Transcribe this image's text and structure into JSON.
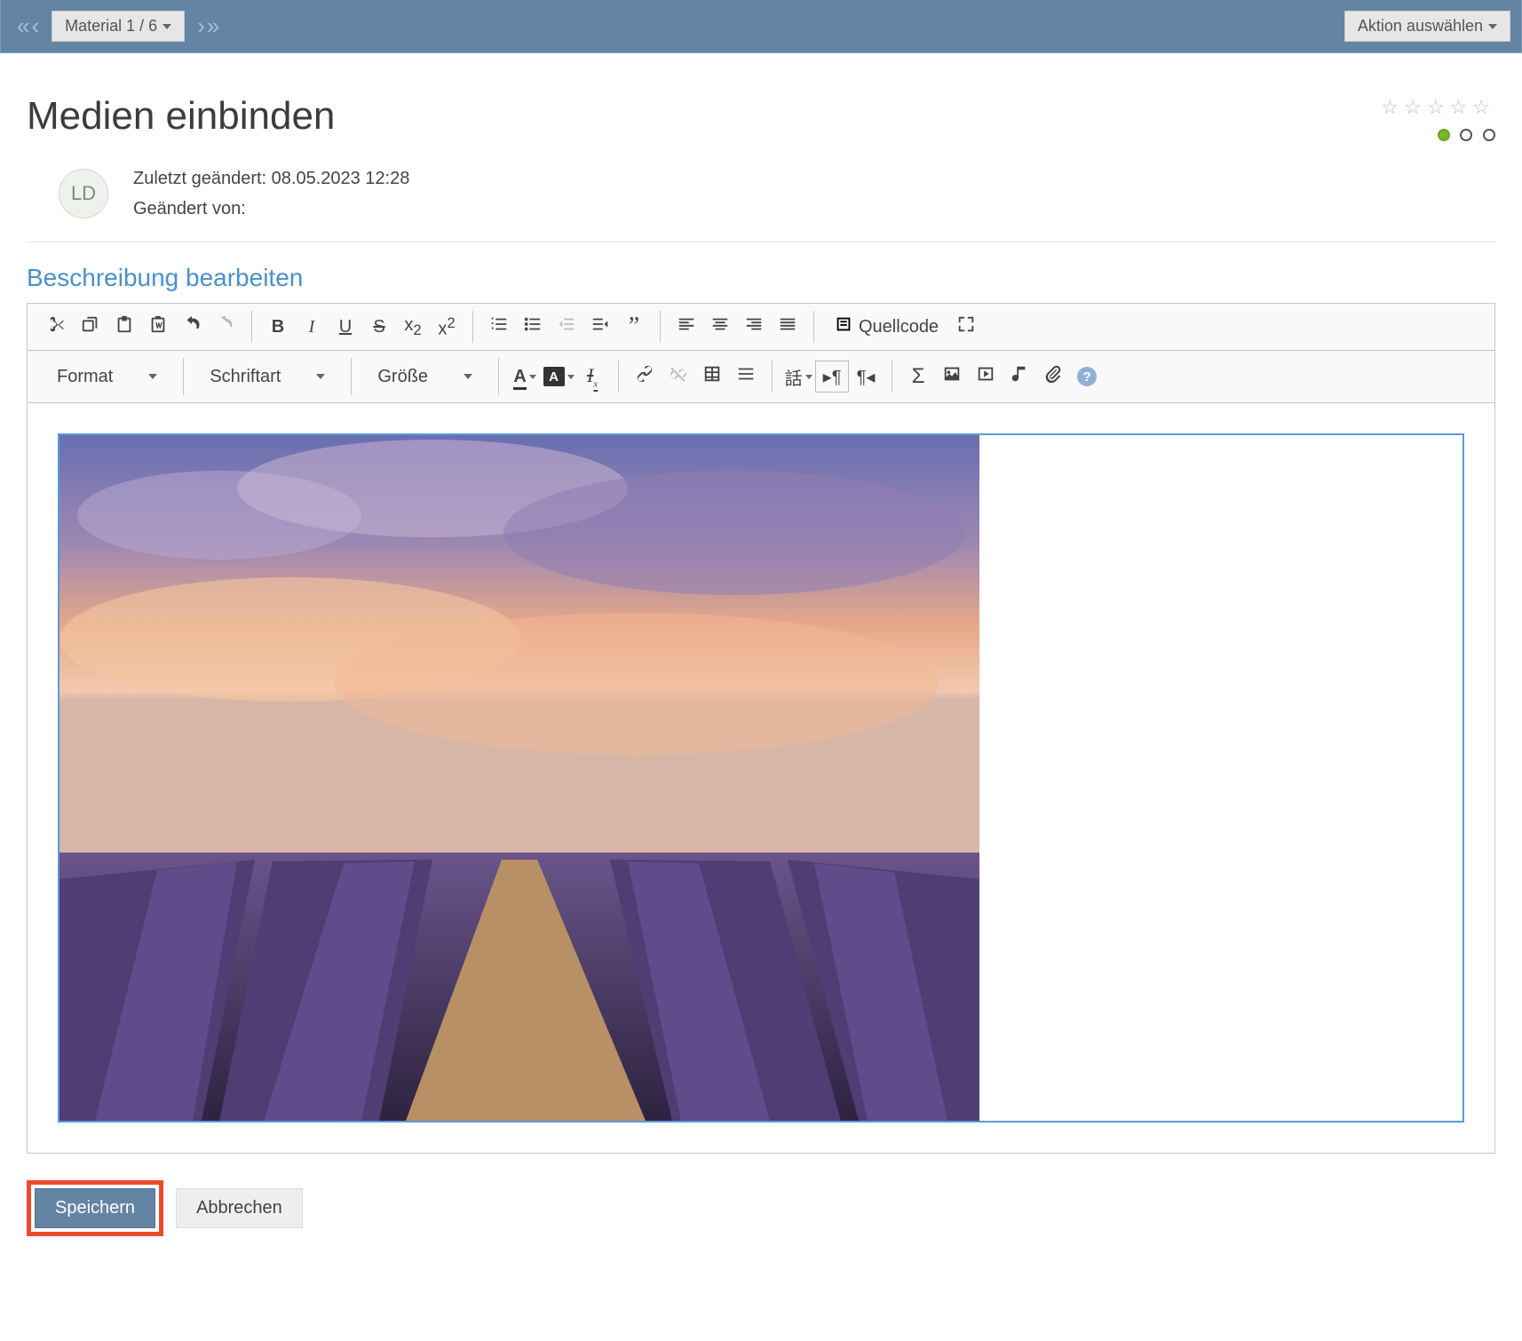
{
  "topbar": {
    "material_label": "Material 1 / 6",
    "action_label": "Aktion auswählen"
  },
  "page": {
    "title": "Medien einbinden",
    "last_modified_label": "Zuletzt geändert:",
    "last_modified_value": "08.05.2023 12:28",
    "modified_by_label": "Geändert von:",
    "avatar_initials": "LD"
  },
  "section": {
    "heading": "Beschreibung bearbeiten"
  },
  "toolbar": {
    "format": "Format",
    "font": "Schriftart",
    "size": "Größe",
    "source": "Quellcode"
  },
  "buttons": {
    "save": "Speichern",
    "cancel": "Abbrechen"
  },
  "status": {
    "star_count": 5,
    "stage": 1,
    "stage_total": 3
  },
  "editor_content": {
    "image_alt": "Lavendelfeld bei Sonnenuntergang"
  }
}
